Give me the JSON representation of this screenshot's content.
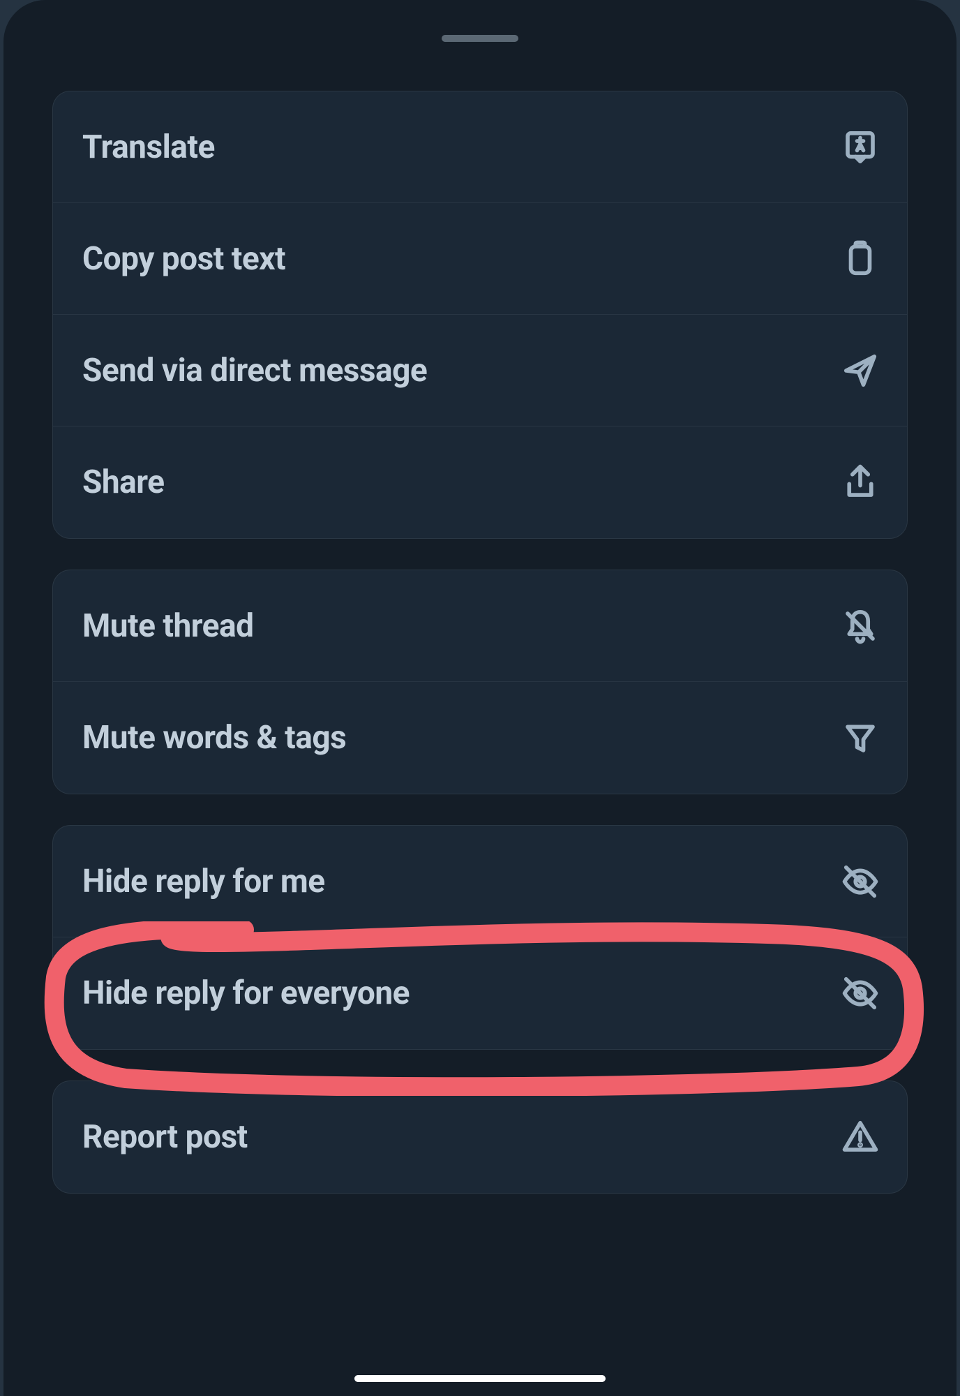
{
  "menu": {
    "groups": [
      {
        "items": [
          {
            "id": "translate",
            "label": "Translate",
            "icon": "translate-icon"
          },
          {
            "id": "copy-text",
            "label": "Copy post text",
            "icon": "clipboard-icon"
          },
          {
            "id": "send-dm",
            "label": "Send via direct message",
            "icon": "send-icon"
          },
          {
            "id": "share",
            "label": "Share",
            "icon": "share-icon"
          }
        ]
      },
      {
        "items": [
          {
            "id": "mute-thread",
            "label": "Mute thread",
            "icon": "mute-icon"
          },
          {
            "id": "mute-words",
            "label": "Mute words & tags",
            "icon": "filter-icon"
          }
        ]
      },
      {
        "items": [
          {
            "id": "hide-for-me",
            "label": "Hide reply for me",
            "icon": "eye-off-icon"
          },
          {
            "id": "hide-for-everyone",
            "label": "Hide reply for everyone",
            "icon": "eye-off-icon"
          }
        ]
      },
      {
        "items": [
          {
            "id": "report",
            "label": "Report post",
            "icon": "warning-icon"
          }
        ]
      }
    ]
  },
  "annotation": {
    "highlighted_item": "hide-for-everyone",
    "color": "#f0616b"
  }
}
